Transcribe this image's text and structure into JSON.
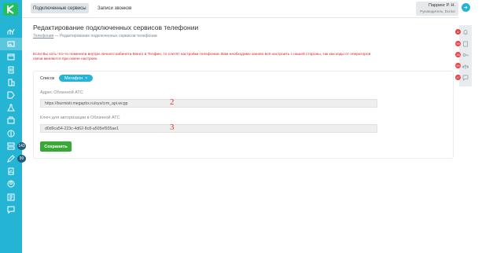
{
  "topbar": {
    "tabs": [
      {
        "label": "Подключенные сервисы",
        "active": true
      },
      {
        "label": "Записи звонков",
        "active": false
      }
    ],
    "user": {
      "name": "Парринг Р. Н.",
      "role": "Руководитель, Doctor"
    }
  },
  "sidebar": {
    "badges": [
      "143",
      "99"
    ],
    "icons": [
      "chart-icon",
      "image-icon",
      "calendar-icon",
      "clipboard-icon",
      "building-icon",
      "tag-icon",
      "flask-icon",
      "bag-icon",
      "coin-icon",
      "server-icon",
      "edit-icon",
      "document-chart-icon",
      "person-icon",
      "notes-icon",
      "chat-icon"
    ]
  },
  "right_rail": {
    "badges": [
      "6",
      "99",
      "28",
      "99",
      "17"
    ]
  },
  "page": {
    "title": "Редактирование подключенных сервисов телефонии",
    "breadcrumb_link": "Телефония",
    "breadcrumb_sep": " — ",
    "breadcrumb_current": "Редактирование подключенных сервисов телефонии",
    "warning": "Если Вы хоть что-то поменяли внутри личного кабинета Манго и Телфин, то слетят настройки телефонии. Вам необходимо заново всё настроить с нашей стороны, так как коды от операторов связи меняются при смене настроек."
  },
  "card": {
    "tabs": [
      {
        "label": "Список"
      },
      {
        "label": "Мегафон",
        "close": "×"
      }
    ],
    "fields": [
      {
        "label": "Адрес Облачной АТС",
        "value": "https://burmistr.megapbx.ru/sys/crm_api.wcgp",
        "annotation": "2"
      },
      {
        "label": "Ключ для авторизации в Облачной АТС",
        "value": "d0d9ca54-223c-4d62-8c8-a505ef935ae1",
        "annotation": "3"
      }
    ],
    "save_label": "Сохранить"
  },
  "colors": {
    "accent": "#23b5d3",
    "save": "#3aa836",
    "warning": "#e02020",
    "badge": "#e84040"
  }
}
